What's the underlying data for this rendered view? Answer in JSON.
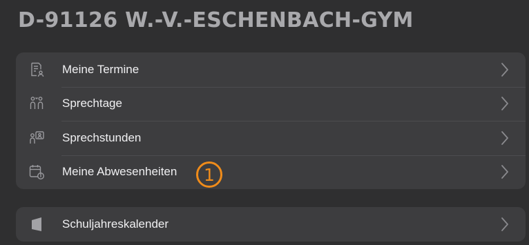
{
  "header": {
    "title": "D-91126 W.-V.-ESCHENBACH-GYM"
  },
  "menu": {
    "items": [
      {
        "label": "Meine Termine",
        "icon": "appointments-icon"
      },
      {
        "label": "Sprechtage",
        "icon": "consultation-days-icon"
      },
      {
        "label": "Sprechstunden",
        "icon": "office-hours-icon"
      },
      {
        "label": "Meine Abwesenheiten",
        "icon": "absence-calendar-icon"
      }
    ]
  },
  "calendar_section": {
    "items": [
      {
        "label": "Schuljahreskalender",
        "icon": "school-calendar-icon"
      }
    ]
  },
  "annotation": {
    "marker": "1",
    "color": "#f08c1a"
  },
  "colors": {
    "background": "#2f2f30",
    "group": "#3d3d3f",
    "title": "#a9a9ac",
    "text": "#f0f0f2",
    "icon": "#9a9a9e"
  }
}
